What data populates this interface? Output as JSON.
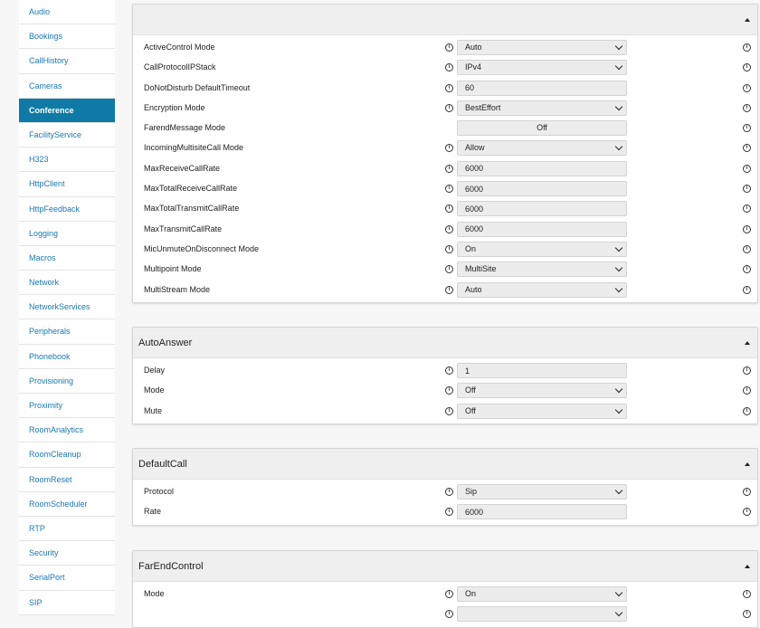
{
  "sidebar": {
    "items": [
      {
        "label": "Audio"
      },
      {
        "label": "Bookings"
      },
      {
        "label": "CallHistory"
      },
      {
        "label": "Cameras"
      },
      {
        "label": "Conference",
        "active": true
      },
      {
        "label": "FacilityService"
      },
      {
        "label": "H323"
      },
      {
        "label": "HttpClient"
      },
      {
        "label": "HttpFeedback"
      },
      {
        "label": "Logging"
      },
      {
        "label": "Macros"
      },
      {
        "label": "Network"
      },
      {
        "label": "NetworkServices"
      },
      {
        "label": "Peripherals"
      },
      {
        "label": "Phonebook"
      },
      {
        "label": "Provisioning"
      },
      {
        "label": "Proximity"
      },
      {
        "label": "RoomAnalytics"
      },
      {
        "label": "RoomCleanup"
      },
      {
        "label": "RoomReset"
      },
      {
        "label": "RoomScheduler"
      },
      {
        "label": "RTP"
      },
      {
        "label": "Security"
      },
      {
        "label": "SerialPort"
      },
      {
        "label": "SIP"
      }
    ]
  },
  "panels": [
    {
      "title": "",
      "rows": [
        {
          "label": "ActiveControl Mode",
          "type": "select",
          "value": "Auto"
        },
        {
          "label": "CallProtocolIPStack",
          "type": "select",
          "value": "IPv4"
        },
        {
          "label": "DoNotDisturb DefaultTimeout",
          "type": "input",
          "value": "60"
        },
        {
          "label": "Encryption Mode",
          "type": "select",
          "value": "BestEffort"
        },
        {
          "label": "FarendMessage Mode",
          "type": "static",
          "value": "Off"
        },
        {
          "label": "IncomingMultisiteCall Mode",
          "type": "select",
          "value": "Allow"
        },
        {
          "label": "MaxReceiveCallRate",
          "type": "input",
          "value": "6000"
        },
        {
          "label": "MaxTotalReceiveCallRate",
          "type": "input",
          "value": "6000"
        },
        {
          "label": "MaxTotalTransmitCallRate",
          "type": "input",
          "value": "6000"
        },
        {
          "label": "MaxTransmitCallRate",
          "type": "input",
          "value": "6000"
        },
        {
          "label": "MicUnmuteOnDisconnect Mode",
          "type": "select",
          "value": "On"
        },
        {
          "label": "Multipoint Mode",
          "type": "select",
          "value": "MultiSite"
        },
        {
          "label": "MultiStream Mode",
          "type": "select",
          "value": "Auto"
        }
      ]
    },
    {
      "title": "AutoAnswer",
      "rows": [
        {
          "label": "Delay",
          "type": "input",
          "value": "1"
        },
        {
          "label": "Mode",
          "type": "select",
          "value": "Off"
        },
        {
          "label": "Mute",
          "type": "select",
          "value": "Off"
        }
      ]
    },
    {
      "title": "DefaultCall",
      "rows": [
        {
          "label": "Protocol",
          "type": "select",
          "value": "Sip"
        },
        {
          "label": "Rate",
          "type": "input",
          "value": "6000"
        }
      ]
    },
    {
      "title": "FarEndControl",
      "rows": [
        {
          "label": "Mode",
          "type": "select",
          "value": "On"
        },
        {
          "label": "",
          "type": "select",
          "value": ""
        }
      ]
    }
  ],
  "icons": {
    "info": "info-circle-icon",
    "collapse": "caret-up-icon",
    "dropdown": "chevron-down-icon"
  }
}
